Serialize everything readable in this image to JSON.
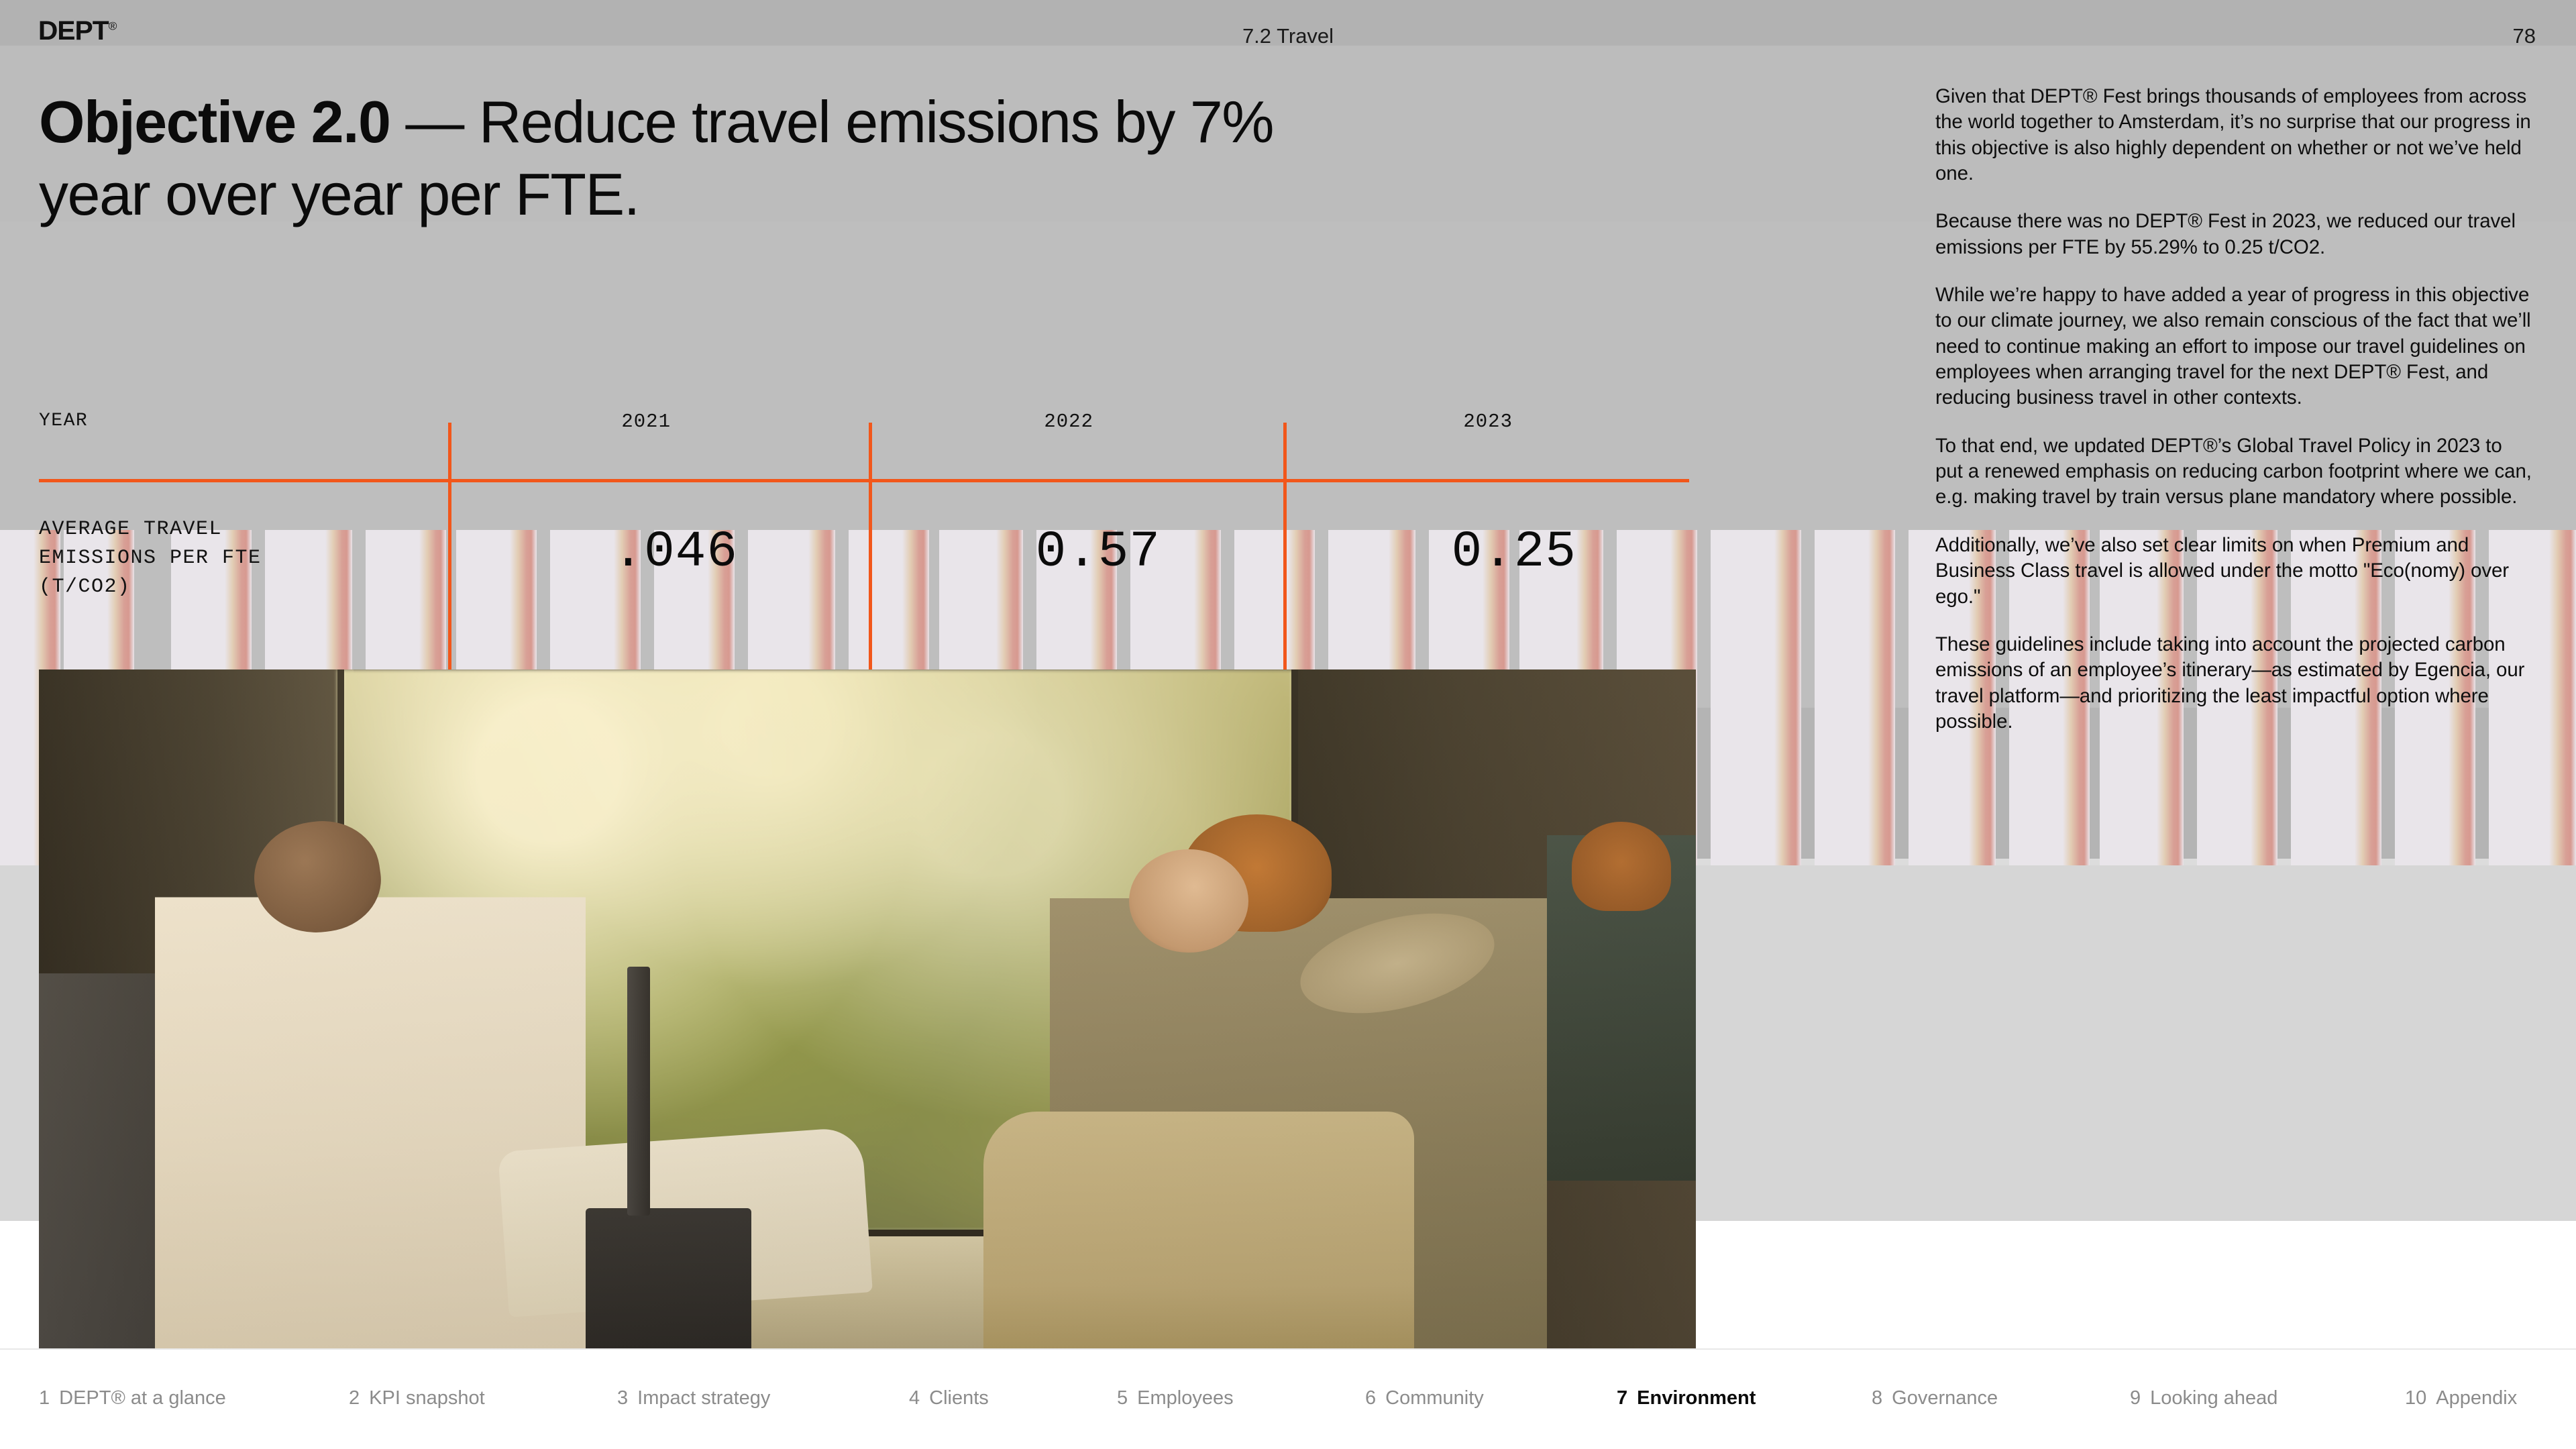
{
  "header": {
    "logo": "DEPT",
    "logo_mark": "®",
    "section": "7.2 Travel",
    "page_number": "78"
  },
  "headline": {
    "bold": "Objective 2.0",
    "rest": " — Reduce travel emissions by 7% year over year per FTE."
  },
  "chart_data": {
    "type": "table",
    "title": "",
    "row_labels": [
      "YEAR",
      "AVERAGE TRAVEL EMISSIONS PER FTE (T/CO2)"
    ],
    "year_label": "YEAR",
    "metric_label_line1": "AVERAGE TRAVEL",
    "metric_label_line2": "EMISSIONS PER FTE",
    "metric_label_line3": "(T/CO2)",
    "categories": [
      "2021",
      "2022",
      "2023"
    ],
    "values": [
      0.046,
      0.57,
      0.25
    ],
    "value_labels": [
      ".046",
      "0.57",
      "0.25"
    ],
    "unit": "t/CO2",
    "accent_color": "#f2571b",
    "grid": false,
    "legend": "none"
  },
  "body": {
    "p1": "Given that DEPT® Fest brings thousands of employees from across the world together to Amsterdam, it’s no surprise that our progress in this objective is also highly dependent on whether or not we’ve held one.",
    "p2": "Because there was no DEPT® Fest in 2023, we reduced our travel emissions per FTE by 55.29% to 0.25 t/CO2.",
    "p3": "While we’re happy to have added a year of progress in this objective to our climate journey, we also remain conscious of the fact that we’ll need to continue making an effort to impose our travel guidelines on employees when arranging travel for the next DEPT® Fest, and reducing business travel in other contexts.",
    "p4": "To that end, we updated DEPT®’s Global Travel Policy in 2023 to put a renewed emphasis on reducing carbon footprint where we can, e.g. making travel by train versus plane mandatory where possible.",
    "p5": "Additionally, we’ve also set clear limits on when Premium and Business Class travel is allowed under the motto \"Eco(nomy) over ego.\"",
    "p6": "These guidelines include taking into account the projected carbon emissions of an employee’s itinerary—as estimated by Egencia, our travel platform—and prioritizing the least impactful option where possible."
  },
  "nav": {
    "items": [
      {
        "num": "1",
        "label": "DEPT® at a glance",
        "active": false
      },
      {
        "num": "2",
        "label": "KPI snapshot",
        "active": false
      },
      {
        "num": "3",
        "label": "Impact strategy",
        "active": false
      },
      {
        "num": "4",
        "label": "Clients",
        "active": false
      },
      {
        "num": "5",
        "label": "Employees",
        "active": false
      },
      {
        "num": "6",
        "label": "Community",
        "active": false
      },
      {
        "num": "7",
        "label": "Environment",
        "active": true
      },
      {
        "num": "8",
        "label": "Governance",
        "active": false
      },
      {
        "num": "9",
        "label": "Looking ahead",
        "active": false
      },
      {
        "num": "10",
        "label": "Appendix",
        "active": false
      }
    ]
  },
  "photo": {
    "alt": "Two travellers seated facing each other on a train beside a window with autumn trees outside"
  },
  "colors": {
    "accent": "#f2571b",
    "background": "#b4b4b4",
    "panel": "#e9e5ea",
    "stripe_warm": "#d8a096",
    "text": "#0e0e0e",
    "nav_inactive": "#8b8b8b"
  }
}
